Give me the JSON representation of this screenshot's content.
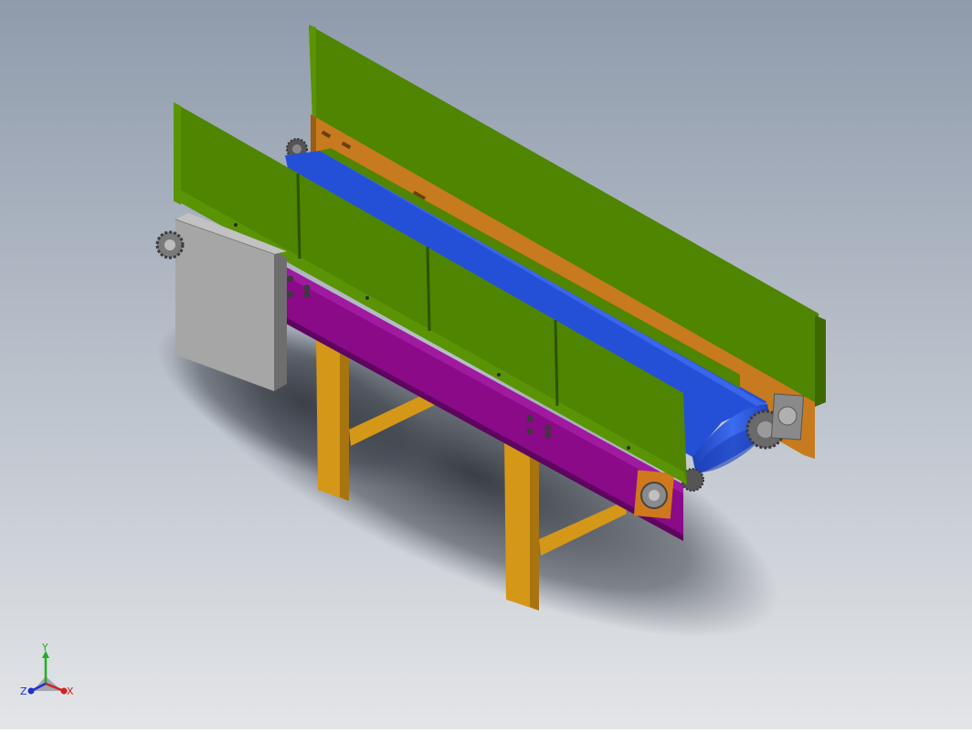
{
  "viewport": {
    "background_top": "#8f9bac",
    "background_bottom": "#e3e5e8"
  },
  "model": {
    "colors": {
      "guard_panel": "#4f8500",
      "guard_panel_light": "#5a9404",
      "guard_panel_dark": "#3d6a00",
      "belt": "#2450d8",
      "belt_light": "#3a66ea",
      "side_frame": "#8a0a88",
      "side_frame_light": "#a01aa0",
      "rear_frame": "#c87a1e",
      "legs": "#d49718",
      "legs_dark": "#a87410",
      "control_box": "#a6a6a6",
      "control_box_dark": "#6e6e6e",
      "hardware": "#8a8a8a"
    }
  },
  "triad": {
    "labels": {
      "x": "X",
      "y": "Y",
      "z": "Z"
    },
    "colors": {
      "x": "#d42020",
      "y": "#20b020",
      "z": "#2030d0"
    }
  }
}
